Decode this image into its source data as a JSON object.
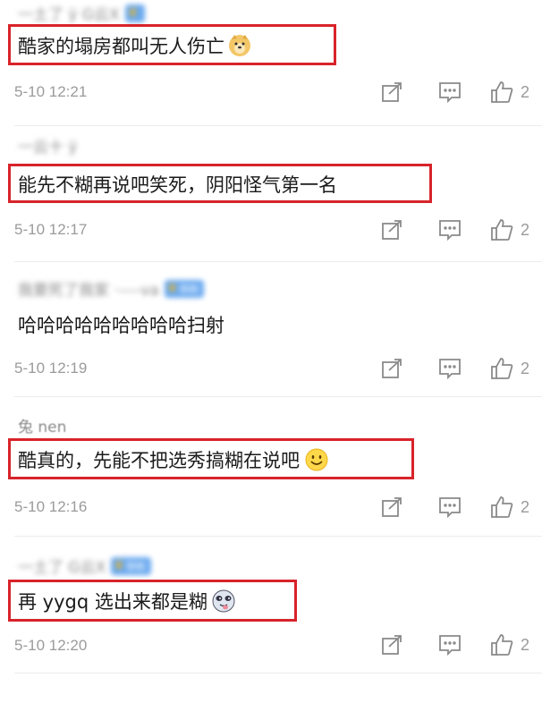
{
  "comments": [
    {
      "username": "一土了 ÿ G云X",
      "badge": "",
      "text": "酷家的塌房都叫无人伤亡",
      "emoji": "doge-emoji",
      "time": "5-10 12:21",
      "likes": "2"
    },
    {
      "username": "一云十 ÿ",
      "badge": "",
      "text": "能先不糊再说吧笑死，阴阳怪气第一名",
      "emoji": "",
      "time": "5-10 12:17",
      "likes": "2"
    },
    {
      "username": "我要死了我家 ·----va",
      "badge": "铁粉",
      "text": "哈哈哈哈哈哈哈哈哈扫射",
      "emoji": "",
      "time": "5-10 12:19",
      "likes": "2"
    },
    {
      "username": "兔 nen",
      "badge": "",
      "text": "酷真的，先能不把选秀搞糊在说吧",
      "emoji": "smile-emoji",
      "time": "5-10 12:16",
      "likes": "2"
    },
    {
      "username": "一土了 G云X",
      "badge": "铁粉",
      "text": "再 yygq 选出来都是糊",
      "emoji": "tongue-emoji",
      "time": "5-10 12:20",
      "likes": "2"
    }
  ],
  "colors": {
    "highlight_box": "#d8232a",
    "badge": "#6aa9ef",
    "meta_text": "#9b9b9b"
  },
  "icons": [
    "share-icon",
    "comment-icon",
    "like-icon"
  ]
}
